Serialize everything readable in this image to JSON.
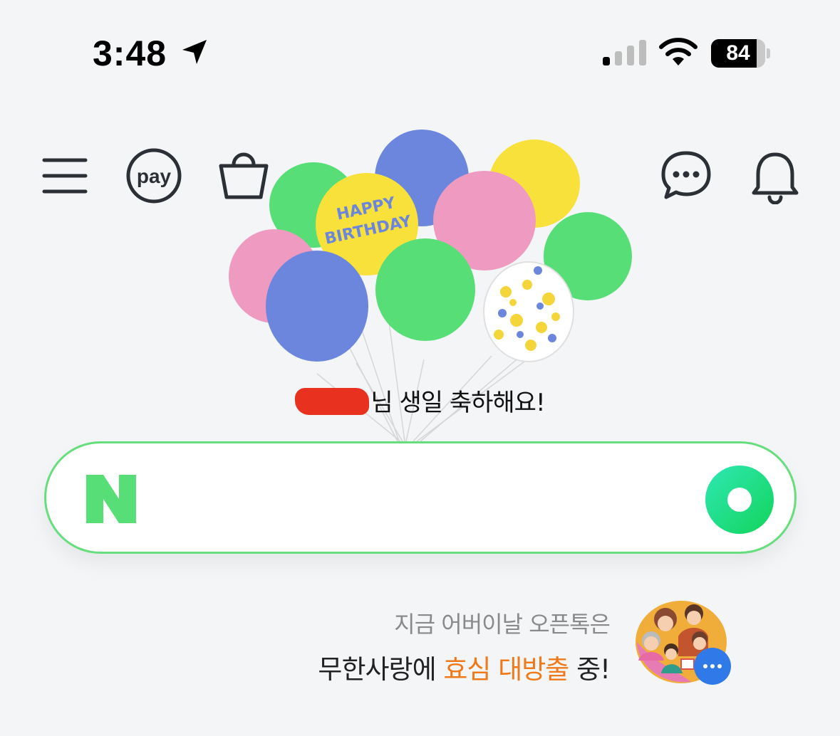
{
  "status_bar": {
    "time": "3:48",
    "battery_percent": "84",
    "battery_level": 0.84,
    "icons": [
      "location-arrow-icon",
      "cellular-signal-icon",
      "wifi-icon",
      "battery-icon"
    ]
  },
  "toolbar": {
    "pay_label": "pay",
    "icons": [
      "menu-icon",
      "pay-icon",
      "shopping-bag-icon",
      "chat-bubble-icon",
      "bell-icon"
    ]
  },
  "birthday": {
    "balloon_text_1": "HAPPY",
    "balloon_text_2": "BIRTHDAY",
    "message": "님 생일 축하해요!"
  },
  "search": {
    "logo_letter": "N",
    "border_color": "#67de7e",
    "accent_color": "#1fd66f"
  },
  "promo": {
    "line1": "지금 어버이날 오픈톡은",
    "line2_prefix": "무한사랑에 ",
    "line2_highlight": "효심 대방출",
    "line2_suffix": " 중!",
    "highlight_color": "#f07a1a"
  }
}
